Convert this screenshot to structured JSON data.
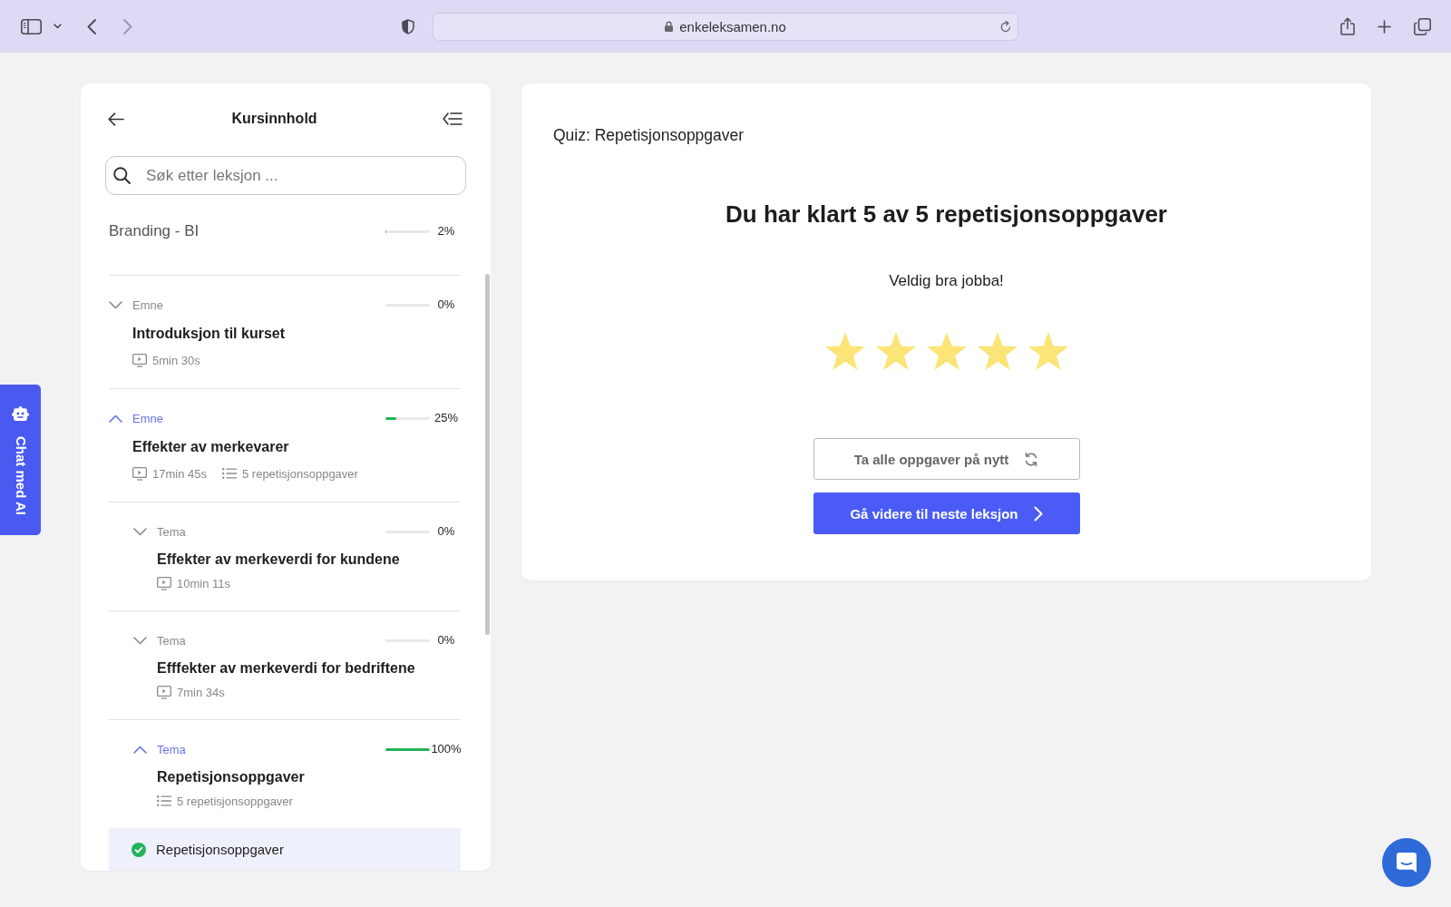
{
  "browser": {
    "url": "enkeleksamen.no"
  },
  "sidebar": {
    "title": "Kursinnhold",
    "search": {
      "placeholder": "Søk etter leksjon ..."
    },
    "course": {
      "name": "Branding - BI",
      "level": 0.02,
      "percent": "2%"
    },
    "items": [
      {
        "kind": "section",
        "label": "Emne",
        "expanded": false,
        "level": 0,
        "percent": "0%",
        "title": "Introduksjon til kurset",
        "meta": [
          {
            "kind": "video",
            "text": "5min 30s"
          }
        ]
      },
      {
        "kind": "section",
        "label": "Emne",
        "expanded": true,
        "level": 0.25,
        "percent": "25%",
        "title": "Effekter av merkevarer",
        "meta": [
          {
            "kind": "video",
            "text": "17min 45s"
          },
          {
            "kind": "quiz",
            "text": "5 repetisjonsoppgaver"
          }
        ],
        "children": [
          {
            "kind": "section",
            "label": "Tema",
            "expanded": false,
            "level": 0,
            "percent": "0%",
            "title": "Effekter av merkeverdi for kundene",
            "meta": [
              {
                "kind": "video",
                "text": "10min 11s"
              }
            ]
          },
          {
            "kind": "section",
            "label": "Tema",
            "expanded": false,
            "level": 0,
            "percent": "0%",
            "title": "Efffekter av merkeverdi for bedriftene",
            "meta": [
              {
                "kind": "video",
                "text": "7min 34s"
              }
            ]
          },
          {
            "kind": "section",
            "label": "Tema",
            "expanded": true,
            "level": 1,
            "percent": "100%",
            "title": "Repetisjonsoppgaver",
            "meta": [
              {
                "kind": "quiz",
                "text": "5 repetisjonsoppgaver"
              }
            ],
            "children": [
              {
                "kind": "lesson",
                "title": "Repetisjonsoppgaver",
                "selected": true,
                "completed": true
              }
            ]
          }
        ]
      }
    ]
  },
  "chat_tab": {
    "label": "Chat med AI"
  },
  "quiz": {
    "title": "Quiz: Repetisjonsoppgaver",
    "heading": "Du har klart 5 av 5 repetisjonsoppgaver",
    "message": "Veldig bra jobba!",
    "stars": 5,
    "buttons": [
      {
        "kind": "secondary",
        "label": "Ta alle oppgaver på nytt"
      },
      {
        "kind": "primary",
        "label": "Gå videre til neste leksjon"
      }
    ]
  }
}
